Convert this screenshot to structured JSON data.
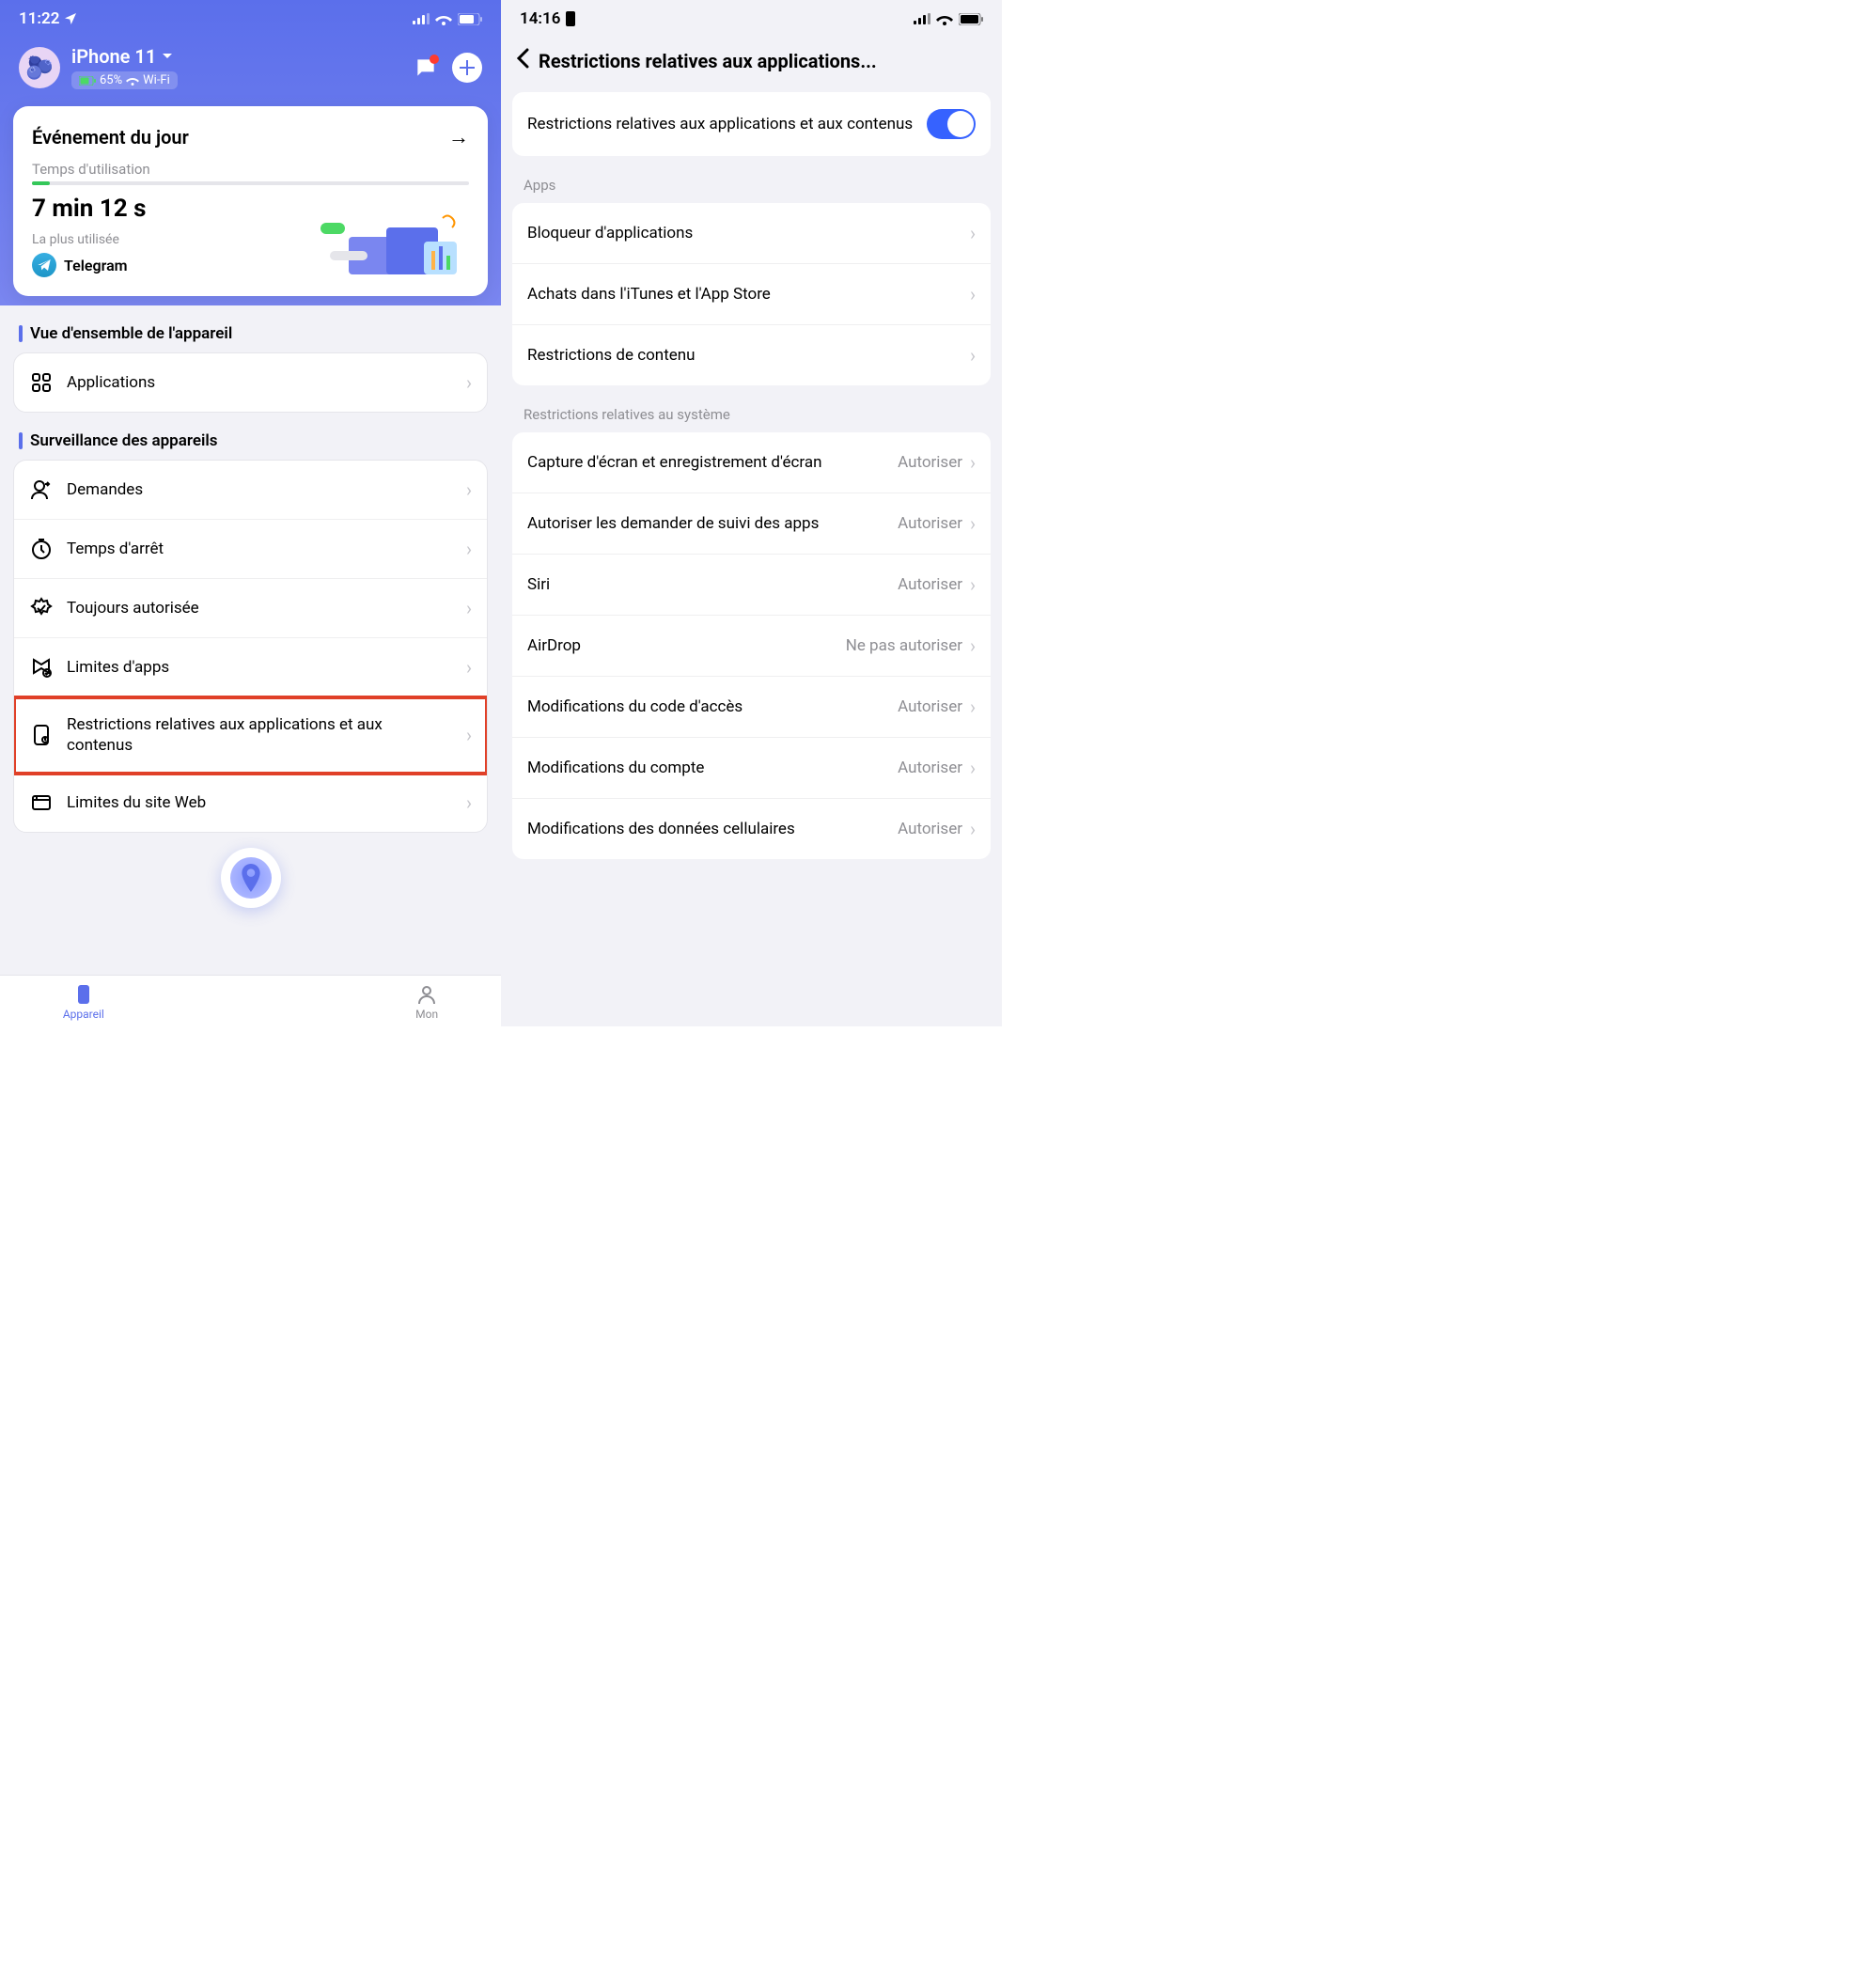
{
  "left": {
    "status_time": "11:22",
    "device_name": "iPhone 11",
    "battery_pct": "65%",
    "wifi_label": "Wi-Fi",
    "event_title": "Événement du jour",
    "usage_label": "Temps d'utilisation",
    "usage_time": "7 min 12 s",
    "most_used_label": "La plus utilisée",
    "most_used_app": "Telegram",
    "section_overview": "Vue d'ensemble de l'appareil",
    "applications": "Applications",
    "section_monitoring": "Surveillance des appareils",
    "monitoring_items": [
      {
        "label": "Demandes"
      },
      {
        "label": "Temps d'arrêt"
      },
      {
        "label": "Toujours autorisée"
      },
      {
        "label": "Limites d'apps"
      },
      {
        "label": "Restrictions relatives aux applications et aux contenus",
        "highlighted": true
      },
      {
        "label": "Limites du site Web"
      }
    ],
    "tab_device": "Appareil",
    "tab_my": "Mon"
  },
  "right": {
    "status_time": "14:16",
    "nav_title": "Restrictions relatives aux applications...",
    "toggle_label": "Restrictions relatives aux applications et aux contenus",
    "group_apps": "Apps",
    "apps_items": [
      {
        "label": "Bloqueur d'applications"
      },
      {
        "label": "Achats dans l'iTunes et l'App Store"
      },
      {
        "label": "Restrictions de contenu"
      }
    ],
    "group_system": "Restrictions relatives au système",
    "system_items": [
      {
        "label": "Capture d'écran et enregistrement d'écran",
        "value": "Autoriser"
      },
      {
        "label": "Autoriser les demander de suivi des apps",
        "value": "Autoriser"
      },
      {
        "label": "Siri",
        "value": "Autoriser"
      },
      {
        "label": "AirDrop",
        "value": "Ne pas autoriser"
      },
      {
        "label": "Modifications du code d'accès",
        "value": "Autoriser"
      },
      {
        "label": "Modifications du compte",
        "value": "Autoriser"
      },
      {
        "label": "Modifications des données cellulaires",
        "value": "Autoriser"
      }
    ]
  }
}
